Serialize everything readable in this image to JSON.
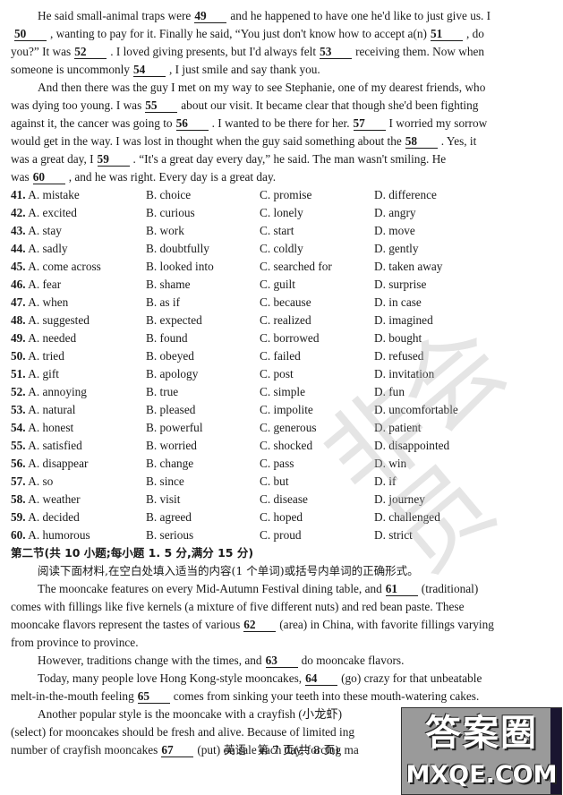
{
  "passage1": {
    "p1": {
      "l1": [
        "He said small-animal traps were",
        "49",
        "and he happened to have one he'd like to just give us. I"
      ],
      "l2": [
        "50",
        ", wanting to pay for it. Finally he said, “You just don't know how to accept a(n)",
        "51",
        ", do"
      ],
      "l3": [
        "you?” It was",
        "52",
        ". I loved giving presents, but I'd always felt",
        "53",
        "receiving them. Now when"
      ],
      "l4": [
        "someone is uncommonly",
        "54",
        ", I just smile and say thank you."
      ]
    },
    "p2": {
      "l1": "And then there was the guy I met on my way to see Stephanie, one of my dearest friends, who",
      "l2": [
        "was dying too young. I was",
        "55",
        "about our visit. It became clear that though she'd been fighting"
      ],
      "l3": [
        "against it, the cancer was going to",
        "56",
        ". I wanted to be there for her.",
        "57",
        "I worried my sorrow"
      ],
      "l4": [
        "would get in the way. I was lost in thought when the guy said something about the",
        "58",
        ". Yes, it"
      ],
      "l5": [
        "was a great day, I",
        "59",
        ". “It's a great day every day,” he said. The man wasn't smiling. He"
      ],
      "l6": [
        "was",
        "60",
        ", and he was right. Every day is a great day."
      ]
    }
  },
  "options": [
    {
      "num": "41.",
      "a": "A. mistake",
      "b": "B. choice",
      "c": "C. promise",
      "d": "D. difference"
    },
    {
      "num": "42.",
      "a": "A. excited",
      "b": "B. curious",
      "c": "C. lonely",
      "d": "D. angry"
    },
    {
      "num": "43.",
      "a": "A. stay",
      "b": "B. work",
      "c": "C. start",
      "d": "D. move"
    },
    {
      "num": "44.",
      "a": "A. sadly",
      "b": "B. doubtfully",
      "c": "C. coldly",
      "d": "D. gently"
    },
    {
      "num": "45.",
      "a": "A. come across",
      "b": "B. looked into",
      "c": "C. searched for",
      "d": "D. taken away"
    },
    {
      "num": "46.",
      "a": "A. fear",
      "b": "B. shame",
      "c": "C. guilt",
      "d": "D. surprise"
    },
    {
      "num": "47.",
      "a": "A. when",
      "b": "B. as if",
      "c": "C. because",
      "d": "D. in case"
    },
    {
      "num": "48.",
      "a": "A. suggested",
      "b": "B. expected",
      "c": "C. realized",
      "d": "D. imagined"
    },
    {
      "num": "49.",
      "a": "A. needed",
      "b": "B. found",
      "c": "C. borrowed",
      "d": "D. bought"
    },
    {
      "num": "50.",
      "a": "A. tried",
      "b": "B. obeyed",
      "c": "C. failed",
      "d": "D. refused"
    },
    {
      "num": "51.",
      "a": "A. gift",
      "b": "B. apology",
      "c": "C. post",
      "d": "D. invitation"
    },
    {
      "num": "52.",
      "a": "A. annoying",
      "b": "B. true",
      "c": "C. simple",
      "d": "D. fun"
    },
    {
      "num": "53.",
      "a": "A. natural",
      "b": "B.  pleased",
      "c": "C. impolite",
      "d": "D. uncomfortable"
    },
    {
      "num": "54.",
      "a": "A. honest",
      "b": "B. powerful",
      "c": "C. generous",
      "d": "D. patient"
    },
    {
      "num": "55.",
      "a": "A. satisfied",
      "b": "B. worried",
      "c": "C. shocked",
      "d": "D. disappointed"
    },
    {
      "num": "56.",
      "a": "A. disappear",
      "b": "B. change",
      "c": "C. pass",
      "d": "D. win"
    },
    {
      "num": "57.",
      "a": "A. so",
      "b": "B. since",
      "c": "C. but",
      "d": "D. if"
    },
    {
      "num": "58.",
      "a": "A. weather",
      "b": "B. visit",
      "c": "C. disease",
      "d": "D. journey"
    },
    {
      "num": "59.",
      "a": "A. decided",
      "b": "B. agreed",
      "c": "C. hoped",
      "d": "D. challenged"
    },
    {
      "num": "60.",
      "a": "A. humorous",
      "b": "B. serious",
      "c": "C. proud",
      "d": "D. strict"
    }
  ],
  "section2": {
    "heading": "第二节(共 10 小题;每小题 1. 5 分,满分 15 分)",
    "instruction": "阅读下面材料,在空白处填入适当的内容(1 个单词)或括号内单词的正确形式。",
    "p1": {
      "l1": [
        "The mooncake features on every Mid-Autumn Festival dining table, and",
        "61",
        "(traditional)"
      ],
      "l2": "comes with fillings like five kernels (a mixture of five different nuts) and red bean paste. These",
      "l3": [
        "mooncake flavors represent the tastes of various",
        "62",
        "(area) in China, with favorite fillings varying"
      ],
      "l4": "from province to province."
    },
    "p2": [
      "However, traditions change with the times, and",
      "63",
      "do mooncake flavors."
    ],
    "p3": {
      "l1": [
        "Today, many people love Hong Kong-style mooncakes,",
        "64",
        "(go) crazy for that unbeatable"
      ],
      "l2": [
        "melt-in-the-mouth feeling",
        "65",
        "comes from sinking your teeth into these mouth-watering cakes."
      ]
    },
    "p4": {
      "l1": "Another popular style is the mooncake with a crayfish (小龙虾)",
      "l2": "(select) for mooncakes should be fresh and alive. Because of limited ing",
      "l3": [
        "number of crayfish mooncakes",
        "67",
        "(put) on sale each day, forcing ma"
      ]
    }
  },
  "footer": "英语　第 7 页(共 8 页)",
  "watermarks": {
    "diagonal_text": "非会员",
    "logo_top": "答案圈",
    "logo_bottom": "MXQE.COM"
  }
}
